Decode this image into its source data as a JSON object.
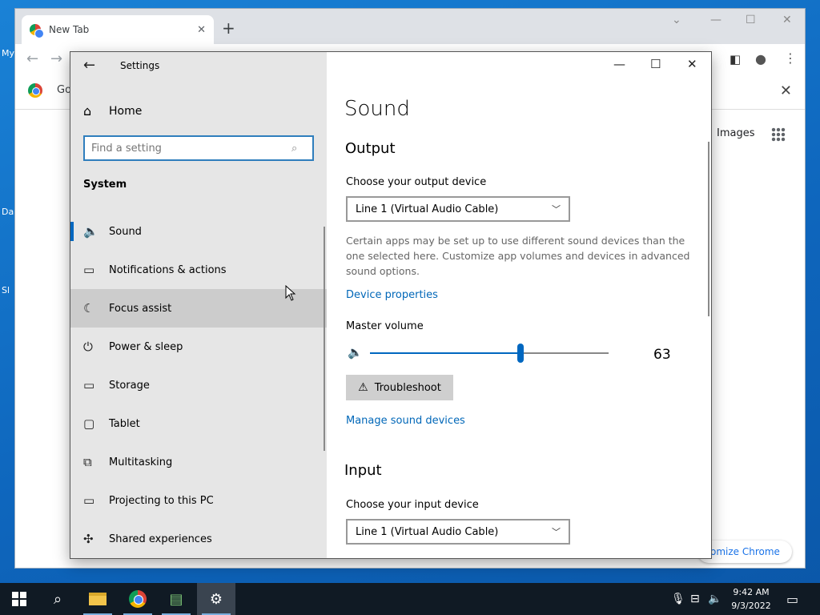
{
  "desktop": {
    "labels": [
      "My",
      "Da",
      "Sl"
    ]
  },
  "chrome": {
    "tab_title": "New Tab",
    "bookmark_text": "Go",
    "images_label": "Images",
    "customize_label": "omize Chrome"
  },
  "settings": {
    "window_title": "Settings",
    "home_label": "Home",
    "search_placeholder": "Find a setting",
    "section_label": "System",
    "nav_items": [
      {
        "label": "Sound",
        "icon": "speaker-icon",
        "glyph": "🔈"
      },
      {
        "label": "Notifications & actions",
        "icon": "notification-icon",
        "glyph": "▭"
      },
      {
        "label": "Focus assist",
        "icon": "moon-icon",
        "glyph": "☾"
      },
      {
        "label": "Power & sleep",
        "icon": "power-icon",
        "glyph": "⏻"
      },
      {
        "label": "Storage",
        "icon": "storage-icon",
        "glyph": "▭"
      },
      {
        "label": "Tablet",
        "icon": "tablet-icon",
        "glyph": "▢"
      },
      {
        "label": "Multitasking",
        "icon": "multitasking-icon",
        "glyph": "⧉"
      },
      {
        "label": "Projecting to this PC",
        "icon": "projector-icon",
        "glyph": "▭"
      },
      {
        "label": "Shared experiences",
        "icon": "shared-icon",
        "glyph": "✣"
      }
    ],
    "selected_index": 0,
    "hover_index": 2
  },
  "sound": {
    "page_title": "Sound",
    "output_heading": "Output",
    "output_label": "Choose your output device",
    "output_device": "Line 1 (Virtual Audio Cable)",
    "description": "Certain apps may be set up to use different sound devices than the one selected here. Customize app volumes and devices in advanced sound options.",
    "device_properties_link": "Device properties",
    "master_volume_label": "Master volume",
    "master_volume": 63,
    "master_volume_text": "63",
    "troubleshoot_label": "Troubleshoot",
    "manage_link": "Manage sound devices",
    "input_heading": "Input",
    "input_label": "Choose your input device",
    "input_device": "Line 1 (Virtual Audio Cable)"
  },
  "taskbar": {
    "time": "9:42 AM",
    "date": "9/3/2022"
  },
  "colors": {
    "accent": "#0067c0",
    "link": "#0067b8",
    "taskbar": "#101a24"
  }
}
